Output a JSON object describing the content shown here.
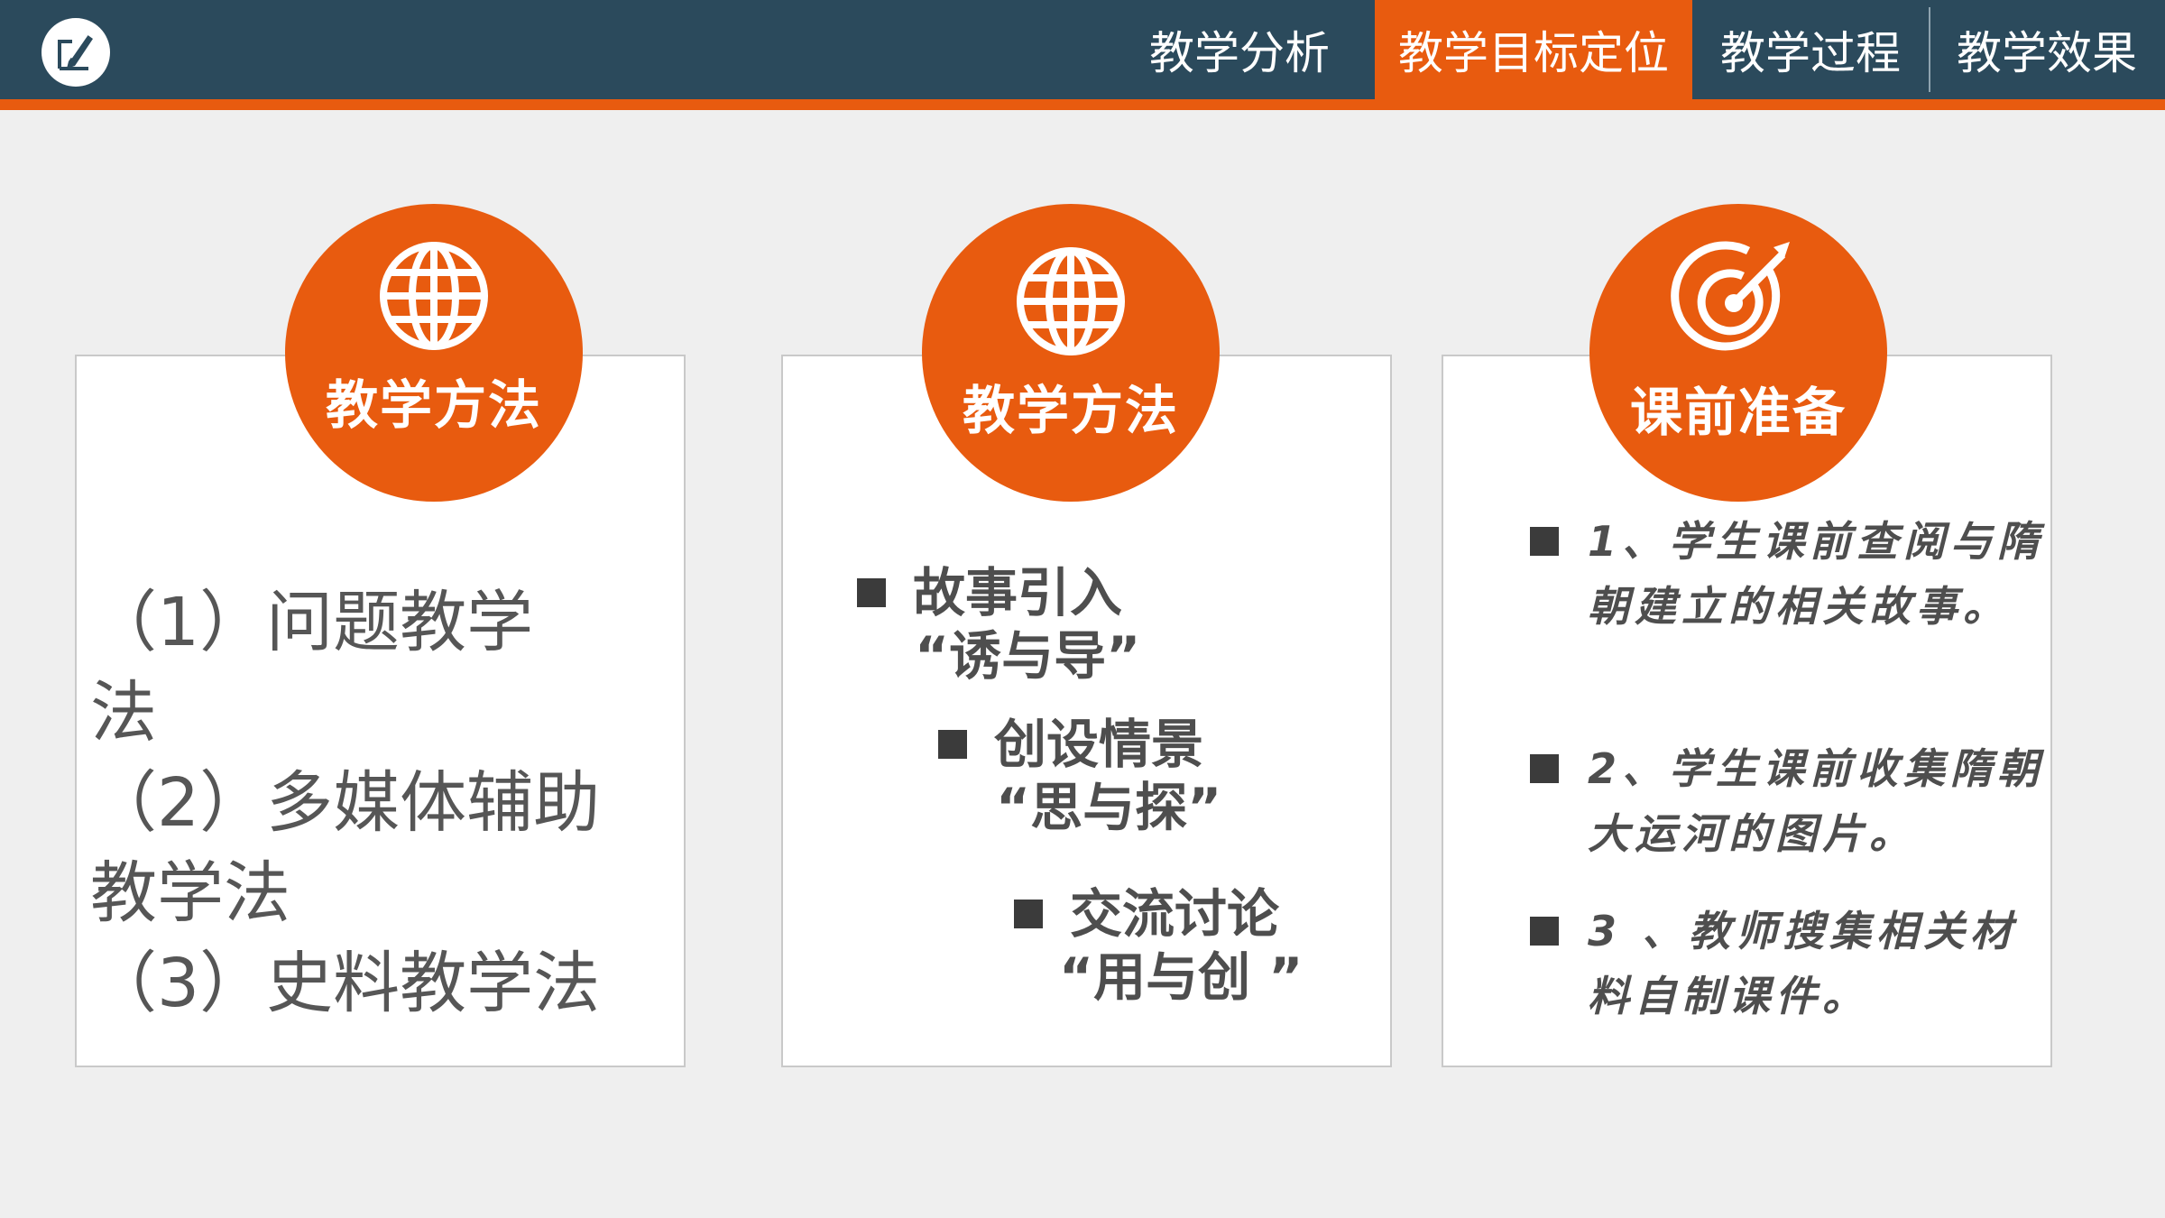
{
  "header": {
    "logo_icon": "pencil-note-icon",
    "nav": [
      {
        "label": "教学分析",
        "active": false
      },
      {
        "label": "教学目标定位",
        "active": true
      },
      {
        "label": "教学过程",
        "active": false
      },
      {
        "label": "教学效果",
        "active": false
      }
    ]
  },
  "colors": {
    "accent": "#e85b0f",
    "header_bg": "#2b4a5c"
  },
  "cards": [
    {
      "icon": "globe-icon",
      "title": "教学方法",
      "lines": [
        "（1）问题教学",
        "法",
        "（2）多媒体辅助",
        "教学法",
        "（3）史料教学法"
      ]
    },
    {
      "icon": "globe-icon",
      "title": "教学方法",
      "items": [
        {
          "label": "故事引入",
          "sub": "“诱与导”"
        },
        {
          "label": "创设情景",
          "sub": "“思与探”"
        },
        {
          "label": "交流讨论",
          "sub": "“用与创 ”"
        }
      ]
    },
    {
      "icon": "target-icon",
      "title": "课前准备",
      "items": [
        "1、学生课前查阅与隋朝建立的相关故事。",
        "2、学生课前收集隋朝大运河的图片。",
        "3 、教师搜集相关材料自制课件。"
      ]
    }
  ]
}
